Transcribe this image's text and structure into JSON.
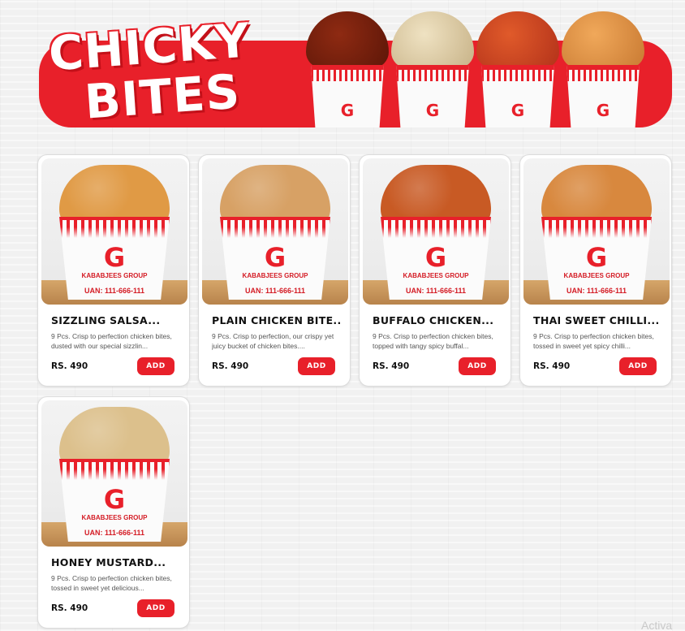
{
  "banner": {
    "title_line1": "CHICKY",
    "title_line2": "BITES",
    "bucket_brand": "KABABJEES GROUP",
    "accent_color": "#e8202a"
  },
  "products": [
    {
      "title": "SIZZLING SALSA...",
      "description": "9 Pcs. Crisp to perfection chicken bites, dusted with our special sizzlin...",
      "price": "RS. 490",
      "add_label": "ADD",
      "food_color": "#e09a45",
      "cup_brand": "KABABJEES GROUP",
      "uan": "UAN: 111-666-111"
    },
    {
      "title": "PLAIN CHICKEN BITE...",
      "description": "9 Pcs. Crisp to perfection, our crispy yet juicy bucket of chicken bites....",
      "price": "RS. 490",
      "add_label": "ADD",
      "food_color": "#d7a165",
      "cup_brand": "KABABJEES GROUP",
      "uan": "UAN: 111-666-111"
    },
    {
      "title": "BUFFALO CHICKEN...",
      "description": "9 Pcs. Crisp to perfection chicken bites, topped with tangy spicy buffal...",
      "price": "RS. 490",
      "add_label": "ADD",
      "food_color": "#c85a24",
      "cup_brand": "KABABJEES GROUP",
      "uan": "UAN: 111-666-111"
    },
    {
      "title": "THAI SWEET CHILLI...",
      "description": "9 Pcs. Crisp to perfection chicken bites, tossed in sweet yet spicy chilli...",
      "price": "RS. 490",
      "add_label": "ADD",
      "food_color": "#d8883e",
      "cup_brand": "KABABJEES GROUP",
      "uan": "UAN: 111-666-111"
    },
    {
      "title": "HONEY MUSTARD...",
      "description": "9 Pcs. Crisp to perfection chicken bites, tossed in sweet yet delicious...",
      "price": "RS. 490",
      "add_label": "ADD",
      "food_color": "#dcc08c",
      "cup_brand": "KABABJEES GROUP",
      "uan": "UAN: 111-666-111"
    }
  ],
  "watermark": "Activa"
}
